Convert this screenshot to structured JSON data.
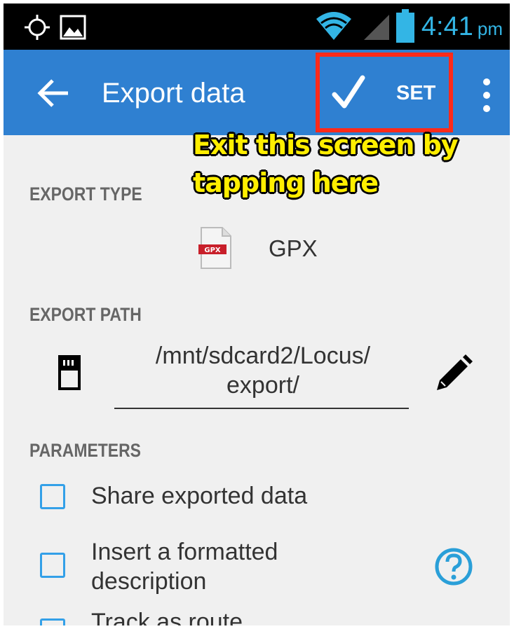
{
  "status_bar": {
    "time": "4:41",
    "ampm": "pm",
    "icons": [
      "gps-icon",
      "image-icon",
      "wifi-icon",
      "signal-icon",
      "battery-icon"
    ],
    "accent_color": "#33b5e5"
  },
  "action_bar": {
    "title": "Export data",
    "set_label": "SET",
    "background_color": "#2f80d1"
  },
  "annotation": {
    "line1": "Exit this screen by",
    "line2": "tapping here",
    "text_color": "#ffee00",
    "box_color": "#ff2a1a"
  },
  "export_type": {
    "heading": "EXPORT TYPE",
    "icon_label": "GPX",
    "value": "GPX"
  },
  "export_path": {
    "heading": "EXPORT PATH",
    "line1": "/mnt/sdcard2/Locus/",
    "line2": "export/"
  },
  "parameters": {
    "heading": "PARAMETERS",
    "options": [
      {
        "label": "Share exported data",
        "checked": false
      },
      {
        "label_line1": "Insert a formatted",
        "label_line2": "description",
        "checked": false
      },
      {
        "label": "Track as route",
        "checked": false
      }
    ]
  }
}
